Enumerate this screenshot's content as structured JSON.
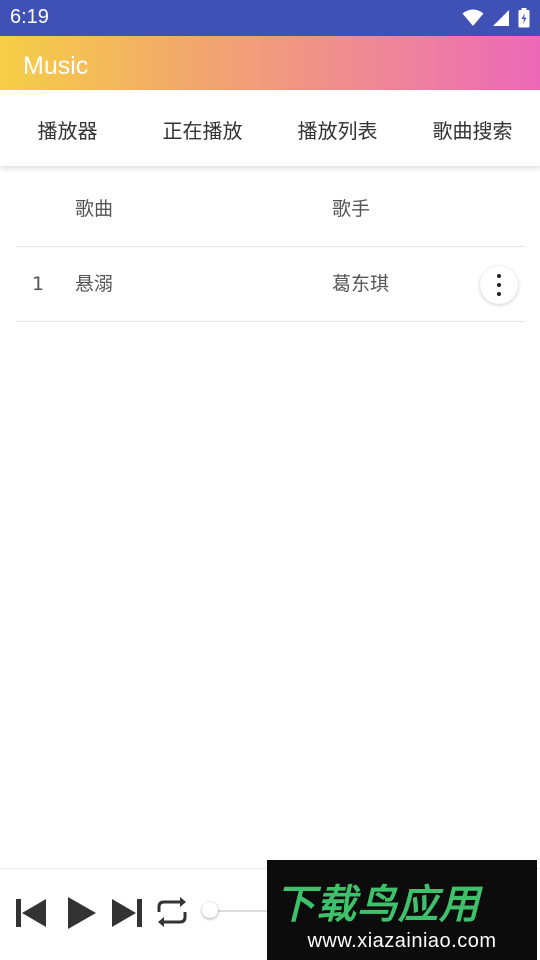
{
  "status_bar": {
    "time": "6:19"
  },
  "app_bar": {
    "title": "Music"
  },
  "tabs": [
    {
      "label": "播放器"
    },
    {
      "label": "正在播放"
    },
    {
      "label": "播放列表"
    },
    {
      "label": "歌曲搜索"
    }
  ],
  "table": {
    "headers": {
      "song": "歌曲",
      "artist": "歌手"
    },
    "rows": [
      {
        "index": "1",
        "song": "悬溺",
        "artist": "葛东琪"
      }
    ]
  },
  "player": {
    "progress_fraction": 0.0
  },
  "watermark": {
    "brand": "下载鸟应用",
    "url": "www.xiazainiao.com"
  },
  "colors": {
    "status_bar": "#3f51b5",
    "gradient_start": "#f5cf45",
    "gradient_end": "#ec69b9",
    "watermark_green": "#3fc06a"
  },
  "icons": [
    "wifi-icon",
    "signal-icon",
    "battery-icon",
    "more-vert-icon",
    "skip-previous-icon",
    "play-icon",
    "skip-next-icon",
    "repeat-icon"
  ]
}
